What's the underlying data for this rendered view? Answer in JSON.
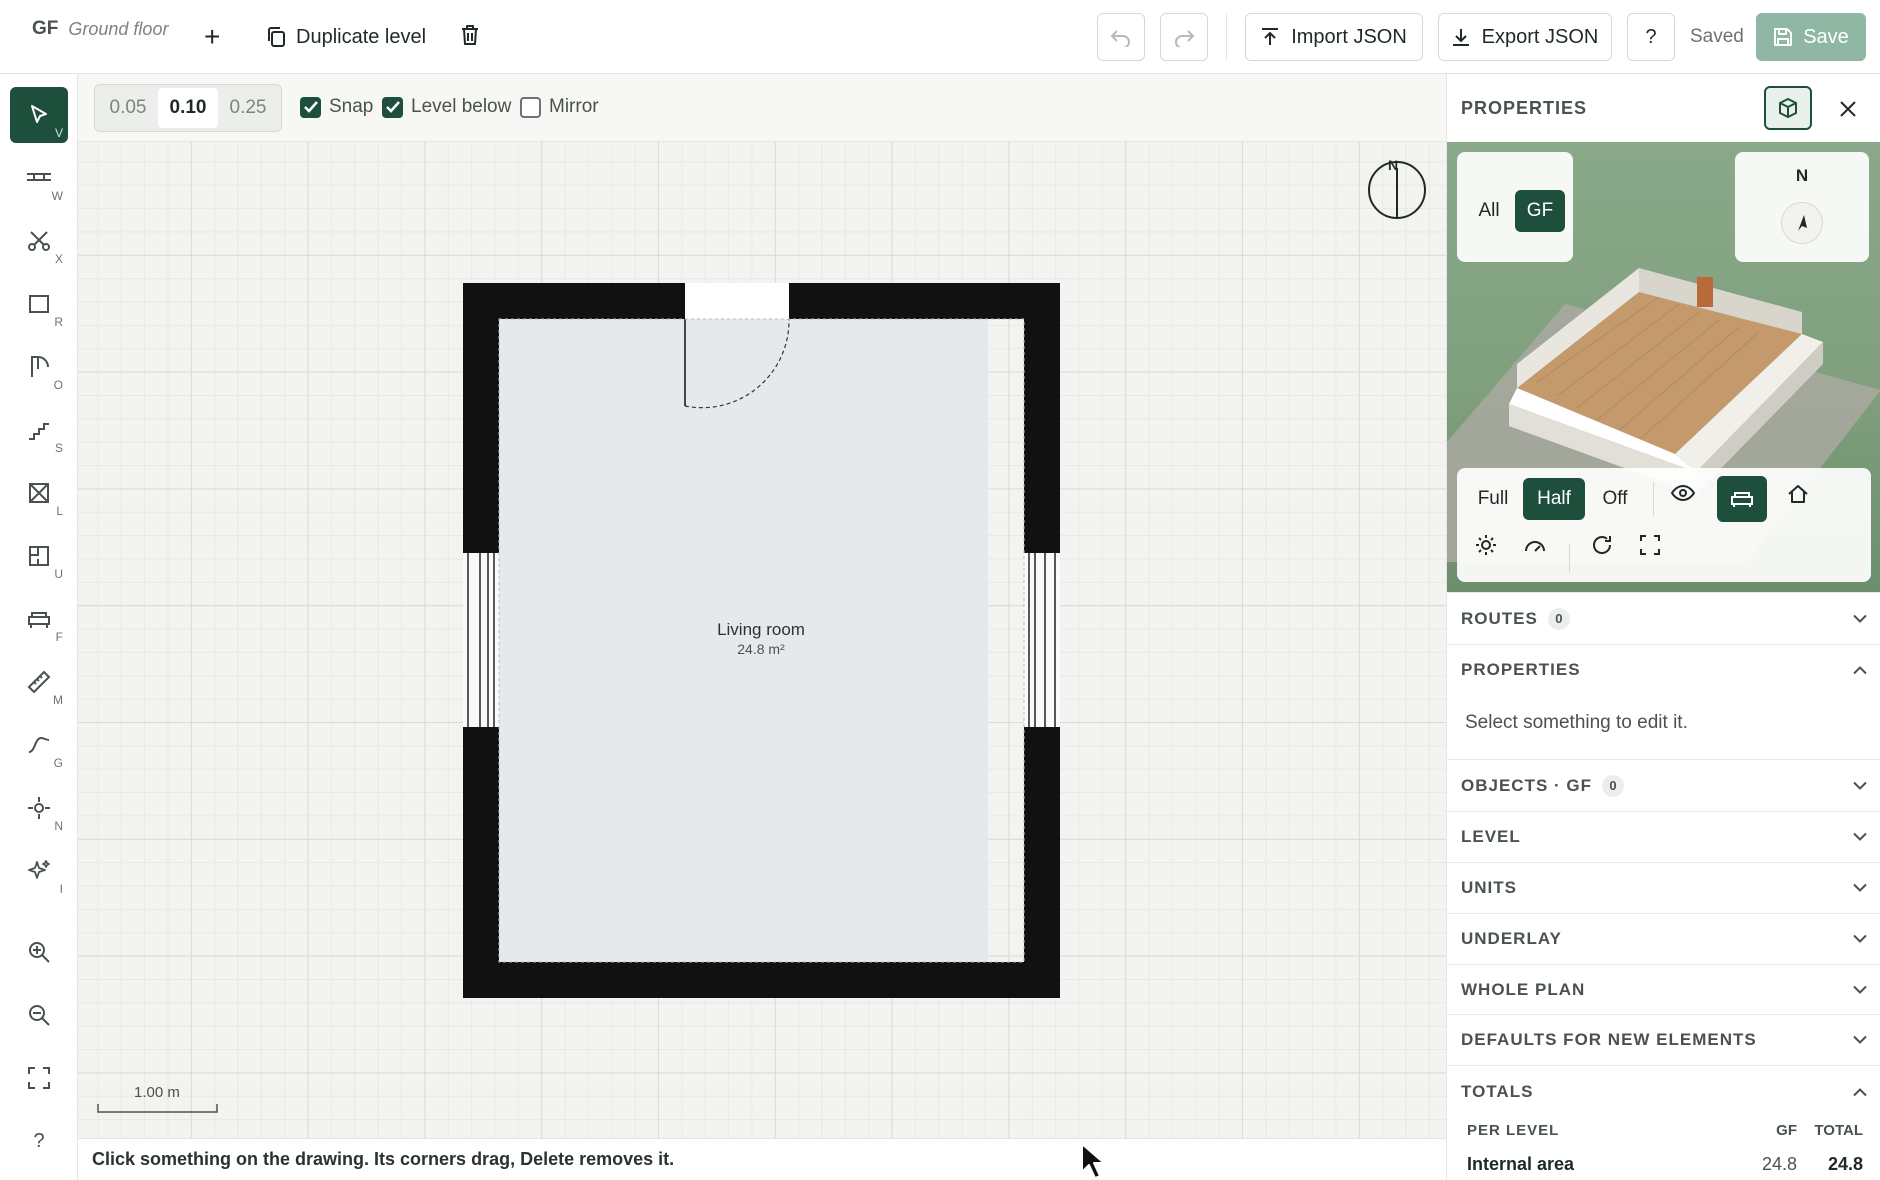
{
  "topbar": {
    "level_code": "GF",
    "level_name": "Ground floor",
    "add_level_label": "+",
    "duplicate_label": "Duplicate level",
    "import_label": "Import JSON",
    "export_label": "Export JSON",
    "help_label": "?",
    "status": "Saved",
    "save_label": "Save"
  },
  "tools": [
    {
      "name": "select",
      "key": "V"
    },
    {
      "name": "wall",
      "key": "W"
    },
    {
      "name": "cut",
      "key": "X"
    },
    {
      "name": "room",
      "key": "R"
    },
    {
      "name": "opening",
      "key": "O"
    },
    {
      "name": "stairs",
      "key": "S"
    },
    {
      "name": "lift",
      "key": "L"
    },
    {
      "name": "unit",
      "key": "U"
    },
    {
      "name": "furniture",
      "key": "F"
    },
    {
      "name": "measure",
      "key": "M"
    },
    {
      "name": "guide",
      "key": "G"
    },
    {
      "name": "north",
      "key": "N"
    },
    {
      "name": "inspect",
      "key": "I"
    }
  ],
  "optbar": {
    "grid_options": [
      "0.05",
      "0.10",
      "0.25"
    ],
    "grid_selected": "0.10",
    "snap_label": "Snap",
    "snap_checked": true,
    "level_below_label": "Level below",
    "level_below_checked": true,
    "mirror_label": "Mirror",
    "mirror_checked": false
  },
  "canvas": {
    "compass_label": "N",
    "room_name": "Living room",
    "room_area": "24.8 m²",
    "scale_label": "1.00 m"
  },
  "statusbar": {
    "message": "Click something on the drawing. Its corners drag, Delete removes it."
  },
  "panel": {
    "title": "PROPERTIES",
    "preview": {
      "level_filter": [
        "All",
        "GF"
      ],
      "level_filter_selected": "GF",
      "compass_label": "N",
      "wall_modes": [
        "Full",
        "Half",
        "Off"
      ],
      "wall_mode_selected": "Half"
    },
    "sections": {
      "routes": "ROUTES",
      "routes_count": "0",
      "properties": "PROPERTIES",
      "properties_hint": "Select something to edit it.",
      "objects": "OBJECTS · GF",
      "objects_count": "0",
      "level": "LEVEL",
      "units": "UNITS",
      "underlay": "UNDERLAY",
      "whole_plan": "WHOLE PLAN",
      "defaults": "DEFAULTS FOR NEW ELEMENTS",
      "totals": "TOTALS"
    },
    "totals": {
      "col_label": "PER LEVEL",
      "col_gf": "GF",
      "col_total": "TOTAL",
      "row_label": "Internal area",
      "row_gf": "24.8",
      "row_total": "24.8"
    }
  },
  "colors": {
    "accent": "#1e4f3c",
    "wall": "#111111",
    "room_fill": "#e6e9eb",
    "save_disabled": "#8fb7a4"
  }
}
